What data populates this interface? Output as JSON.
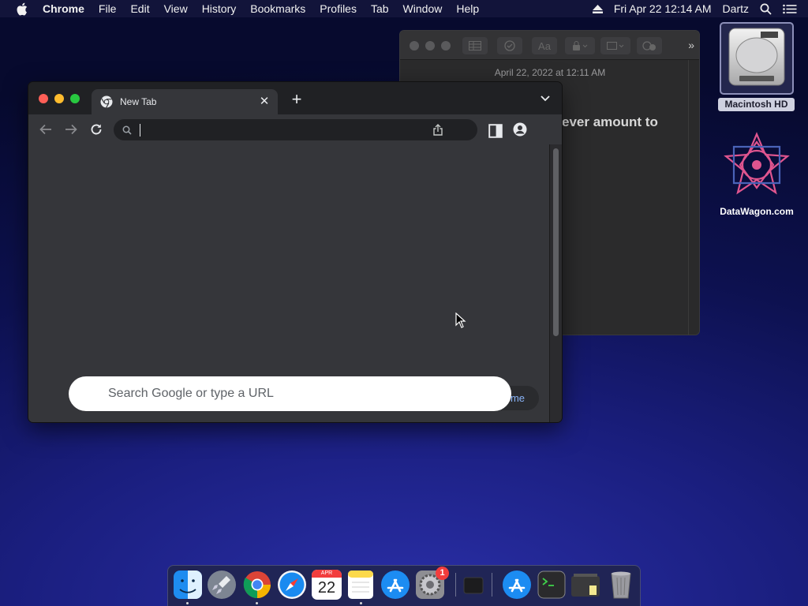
{
  "menubar": {
    "app_name": "Chrome",
    "items": [
      "File",
      "Edit",
      "View",
      "History",
      "Bookmarks",
      "Profiles",
      "Tab",
      "Window",
      "Help"
    ],
    "clock": "Fri Apr 22  12:14 AM",
    "user": "Dartz"
  },
  "notes_window": {
    "date": "April 22, 2022 at 12:11 AM",
    "body_text": "ever amount to"
  },
  "desktop": {
    "hd_label": "Macintosh HD",
    "dw_label": "DataWagon.com"
  },
  "chrome": {
    "tab_title": "New Tab",
    "omnibox_value": "",
    "search_placeholder": "Search Google or type a URL",
    "customize_label": "me"
  },
  "dock": {
    "calendar_month": "APR",
    "calendar_day": "22",
    "settings_badge": "1"
  },
  "colors": {
    "close": "#ff5f57",
    "minimize": "#febc2e",
    "zoom": "#28c840",
    "chrome_bg": "#35363a",
    "link": "#8ab4f8"
  }
}
